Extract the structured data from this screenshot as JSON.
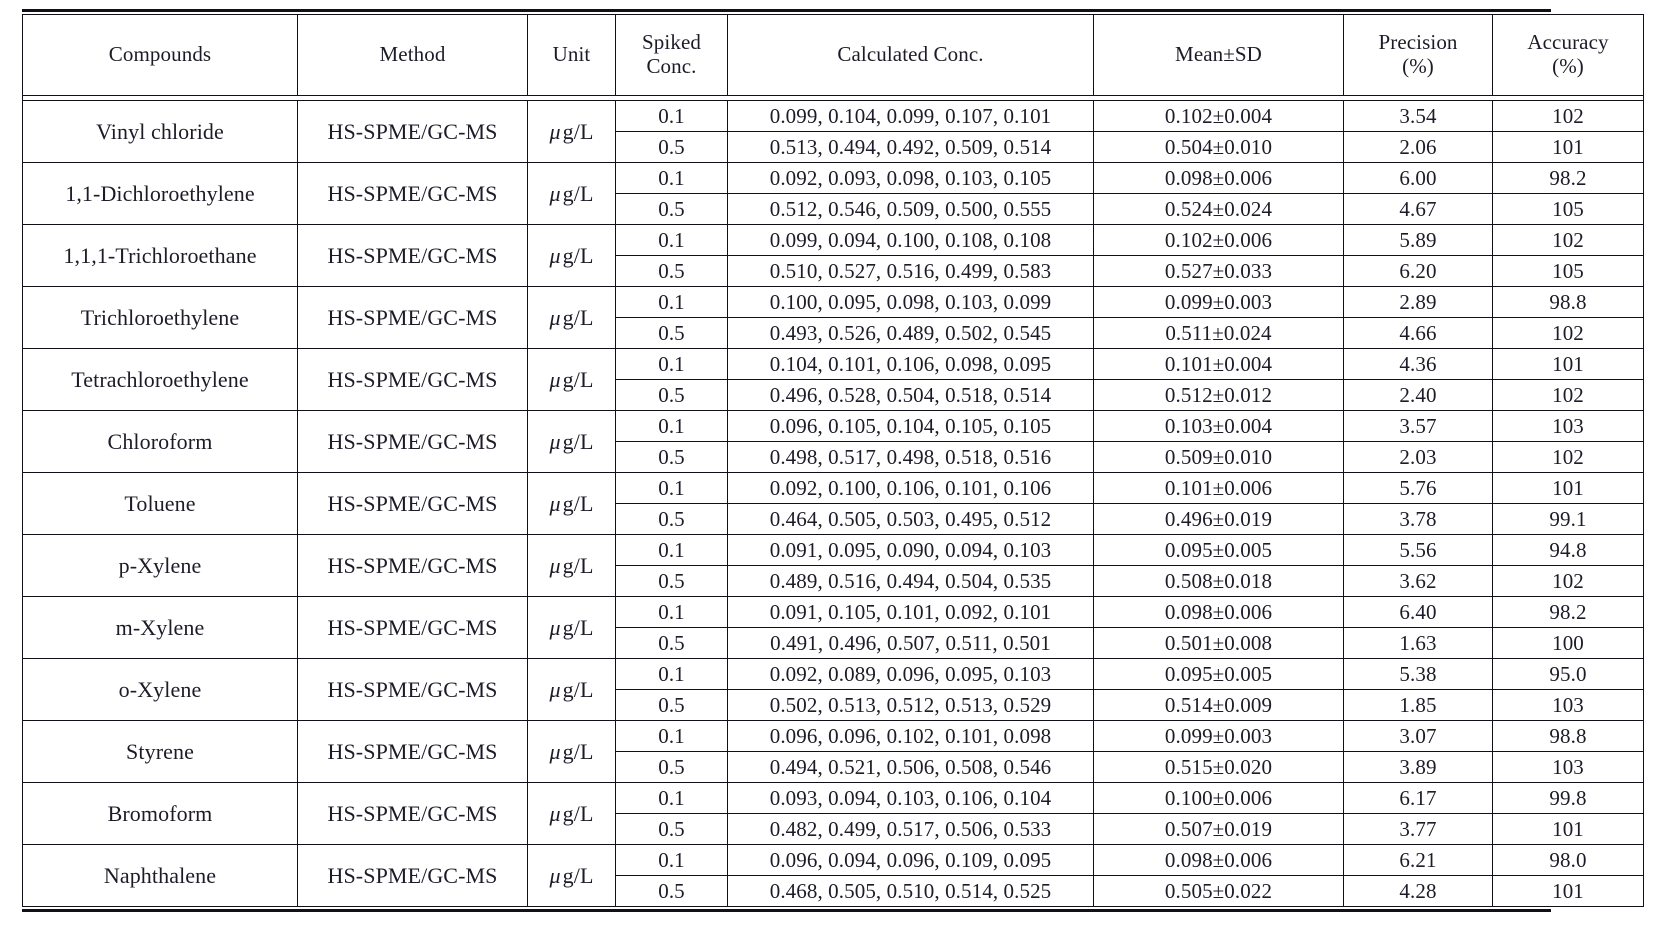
{
  "table": {
    "headers": {
      "compounds": "Compounds",
      "method": "Method",
      "unit": "Unit",
      "spiked_conc_line1": "Spiked",
      "spiked_conc_line2": "Conc.",
      "calculated_conc": "Calculated  Conc.",
      "mean_sd": "Mean±SD",
      "precision_line1": "Precision",
      "precision_line2": "(%)",
      "accuracy_line1": "Accuracy",
      "accuracy_line2": "(%)"
    },
    "unit_value": "g/L",
    "unit_prefix": "μ",
    "method_value": "HS-SPME/GC-MS",
    "rows": [
      {
        "compound": "Vinyl  chloride",
        "method": "HS-SPME/GC-MS",
        "unit": "g/L",
        "levels": [
          {
            "spiked": "0.1",
            "calculated": "0.099,  0.104,  0.099,  0.107,  0.101",
            "mean_sd": "0.102±0.004",
            "precision": "3.54",
            "accuracy": "102"
          },
          {
            "spiked": "0.5",
            "calculated": "0.513,  0.494,  0.492,  0.509,  0.514",
            "mean_sd": "0.504±0.010",
            "precision": "2.06",
            "accuracy": "101"
          }
        ]
      },
      {
        "compound": "1,1-Dichloroethylene",
        "method": "HS-SPME/GC-MS",
        "unit": "g/L",
        "levels": [
          {
            "spiked": "0.1",
            "calculated": "0.092,  0.093,  0.098,  0.103,  0.105",
            "mean_sd": "0.098±0.006",
            "precision": "6.00",
            "accuracy": "98.2"
          },
          {
            "spiked": "0.5",
            "calculated": "0.512,  0.546,  0.509,  0.500,  0.555",
            "mean_sd": "0.524±0.024",
            "precision": "4.67",
            "accuracy": "105"
          }
        ]
      },
      {
        "compound": "1,1,1-Trichloroethane",
        "method": "HS-SPME/GC-MS",
        "unit": "g/L",
        "levels": [
          {
            "spiked": "0.1",
            "calculated": "0.099,  0.094,  0.100,  0.108,  0.108",
            "mean_sd": "0.102±0.006",
            "precision": "5.89",
            "accuracy": "102"
          },
          {
            "spiked": "0.5",
            "calculated": "0.510,  0.527,  0.516,  0.499,  0.583",
            "mean_sd": "0.527±0.033",
            "precision": "6.20",
            "accuracy": "105"
          }
        ]
      },
      {
        "compound": "Trichloroethylene",
        "method": "HS-SPME/GC-MS",
        "unit": "g/L",
        "levels": [
          {
            "spiked": "0.1",
            "calculated": "0.100,  0.095,  0.098,  0.103,  0.099",
            "mean_sd": "0.099±0.003",
            "precision": "2.89",
            "accuracy": "98.8"
          },
          {
            "spiked": "0.5",
            "calculated": "0.493,  0.526,  0.489,  0.502,  0.545",
            "mean_sd": "0.511±0.024",
            "precision": "4.66",
            "accuracy": "102"
          }
        ]
      },
      {
        "compound": "Tetrachloroethylene",
        "method": "HS-SPME/GC-MS",
        "unit": "g/L",
        "levels": [
          {
            "spiked": "0.1",
            "calculated": "0.104,  0.101,  0.106,  0.098,  0.095",
            "mean_sd": "0.101±0.004",
            "precision": "4.36",
            "accuracy": "101"
          },
          {
            "spiked": "0.5",
            "calculated": "0.496,  0.528,  0.504,  0.518,  0.514",
            "mean_sd": "0.512±0.012",
            "precision": "2.40",
            "accuracy": "102"
          }
        ]
      },
      {
        "compound": "Chloroform",
        "method": "HS-SPME/GC-MS",
        "unit": "g/L",
        "levels": [
          {
            "spiked": "0.1",
            "calculated": "0.096,  0.105,  0.104,  0.105,  0.105",
            "mean_sd": "0.103±0.004",
            "precision": "3.57",
            "accuracy": "103"
          },
          {
            "spiked": "0.5",
            "calculated": "0.498,  0.517,  0.498,  0.518,  0.516",
            "mean_sd": "0.509±0.010",
            "precision": "2.03",
            "accuracy": "102"
          }
        ]
      },
      {
        "compound": "Toluene",
        "method": "HS-SPME/GC-MS",
        "unit": "g/L",
        "levels": [
          {
            "spiked": "0.1",
            "calculated": "0.092,  0.100,  0.106,  0.101,  0.106",
            "mean_sd": "0.101±0.006",
            "precision": "5.76",
            "accuracy": "101"
          },
          {
            "spiked": "0.5",
            "calculated": "0.464,  0.505,  0.503,  0.495,  0.512",
            "mean_sd": "0.496±0.019",
            "precision": "3.78",
            "accuracy": "99.1"
          }
        ]
      },
      {
        "compound": "p-Xylene",
        "method": "HS-SPME/GC-MS",
        "unit": "g/L",
        "levels": [
          {
            "spiked": "0.1",
            "calculated": "0.091,  0.095,  0.090,  0.094,  0.103",
            "mean_sd": "0.095±0.005",
            "precision": "5.56",
            "accuracy": "94.8"
          },
          {
            "spiked": "0.5",
            "calculated": "0.489,  0.516,  0.494,  0.504,  0.535",
            "mean_sd": "0.508±0.018",
            "precision": "3.62",
            "accuracy": "102"
          }
        ]
      },
      {
        "compound": "m-Xylene",
        "method": "HS-SPME/GC-MS",
        "unit": "g/L",
        "levels": [
          {
            "spiked": "0.1",
            "calculated": "0.091,  0.105,  0.101,  0.092,  0.101",
            "mean_sd": "0.098±0.006",
            "precision": "6.40",
            "accuracy": "98.2"
          },
          {
            "spiked": "0.5",
            "calculated": "0.491,  0.496,  0.507,  0.511,  0.501",
            "mean_sd": "0.501±0.008",
            "precision": "1.63",
            "accuracy": "100"
          }
        ]
      },
      {
        "compound": "o-Xylene",
        "method": "HS-SPME/GC-MS",
        "unit": "g/L",
        "levels": [
          {
            "spiked": "0.1",
            "calculated": "0.092,  0.089,  0.096,  0.095,  0.103",
            "mean_sd": "0.095±0.005",
            "precision": "5.38",
            "accuracy": "95.0"
          },
          {
            "spiked": "0.5",
            "calculated": "0.502,  0.513,  0.512,  0.513,  0.529",
            "mean_sd": "0.514±0.009",
            "precision": "1.85",
            "accuracy": "103"
          }
        ]
      },
      {
        "compound": "Styrene",
        "method": "HS-SPME/GC-MS",
        "unit": "g/L",
        "levels": [
          {
            "spiked": "0.1",
            "calculated": "0.096,  0.096,  0.102,  0.101,  0.098",
            "mean_sd": "0.099±0.003",
            "precision": "3.07",
            "accuracy": "98.8"
          },
          {
            "spiked": "0.5",
            "calculated": "0.494,  0.521,  0.506,  0.508,  0.546",
            "mean_sd": "0.515±0.020",
            "precision": "3.89",
            "accuracy": "103"
          }
        ]
      },
      {
        "compound": "Bromoform",
        "method": "HS-SPME/GC-MS",
        "unit": "g/L",
        "levels": [
          {
            "spiked": "0.1",
            "calculated": "0.093,  0.094,  0.103,  0.106,  0.104",
            "mean_sd": "0.100±0.006",
            "precision": "6.17",
            "accuracy": "99.8"
          },
          {
            "spiked": "0.5",
            "calculated": "0.482,  0.499,  0.517,  0.506,  0.533",
            "mean_sd": "0.507±0.019",
            "precision": "3.77",
            "accuracy": "101"
          }
        ]
      },
      {
        "compound": "Naphthalene",
        "method": "HS-SPME/GC-MS",
        "unit": "g/L",
        "levels": [
          {
            "spiked": "0.1",
            "calculated": "0.096,  0.094,  0.096,  0.109,  0.095",
            "mean_sd": "0.098±0.006",
            "precision": "6.21",
            "accuracy": "98.0"
          },
          {
            "spiked": "0.5",
            "calculated": "0.468,  0.505,  0.510,  0.514,  0.525",
            "mean_sd": "0.505±0.022",
            "precision": "4.28",
            "accuracy": "101"
          }
        ]
      }
    ]
  }
}
